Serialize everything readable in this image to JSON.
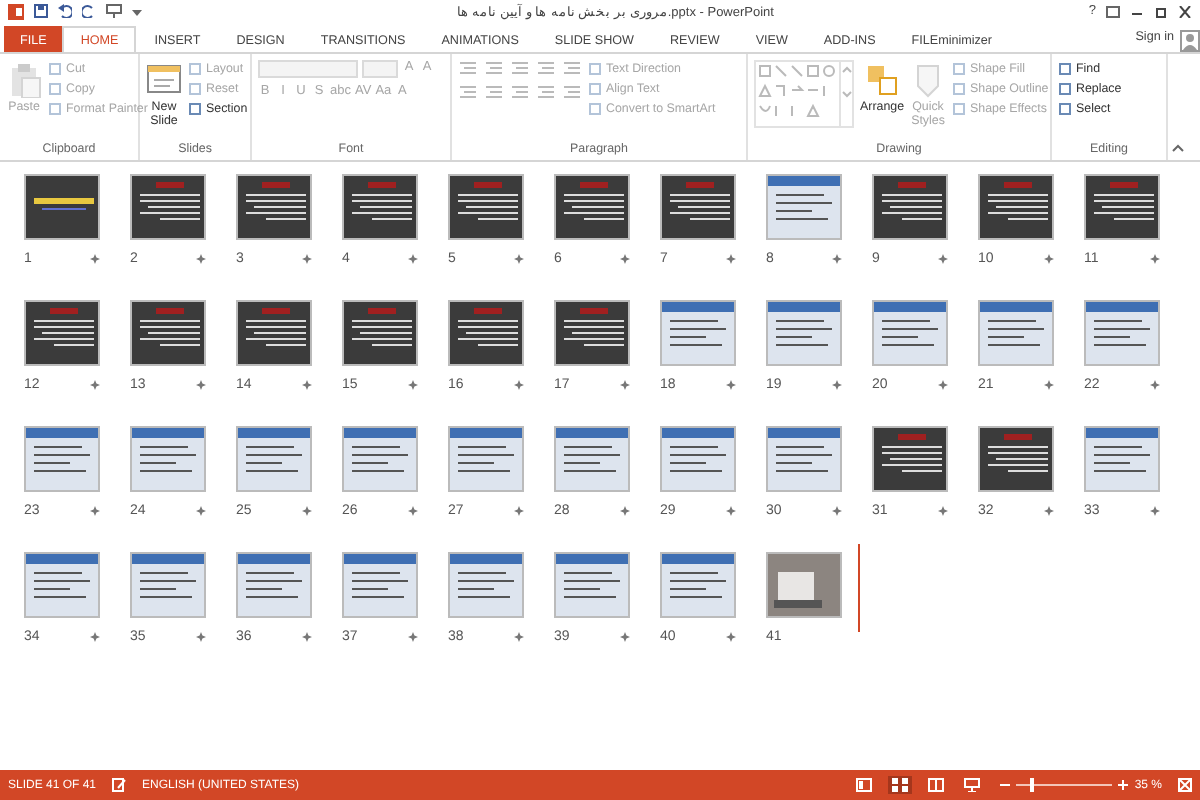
{
  "window": {
    "title": "مروری بر بخش نامه ها و آیین نامه ها.pptx - PowerPoint",
    "help": "?"
  },
  "tabs": [
    {
      "label": "FILE",
      "kind": "file",
      "selected": false
    },
    {
      "label": "HOME",
      "kind": "tab",
      "selected": true
    },
    {
      "label": "INSERT",
      "kind": "tab",
      "selected": false
    },
    {
      "label": "DESIGN",
      "kind": "tab",
      "selected": false
    },
    {
      "label": "TRANSITIONS",
      "kind": "tab",
      "selected": false
    },
    {
      "label": "ANIMATIONS",
      "kind": "tab",
      "selected": false
    },
    {
      "label": "SLIDE SHOW",
      "kind": "tab",
      "selected": false
    },
    {
      "label": "REVIEW",
      "kind": "tab",
      "selected": false
    },
    {
      "label": "VIEW",
      "kind": "tab",
      "selected": false
    },
    {
      "label": "ADD-INS",
      "kind": "tab",
      "selected": false
    },
    {
      "label": "FILEminimizer",
      "kind": "tab",
      "selected": false
    }
  ],
  "sign_in": "Sign in",
  "ribbon_groups": [
    {
      "name": "Clipboard",
      "items": [
        {
          "kind": "large",
          "label": "Paste",
          "disabled": true
        },
        {
          "kind": "small",
          "label": "Cut",
          "disabled": true
        },
        {
          "kind": "small",
          "label": "Copy",
          "disabled": true
        },
        {
          "kind": "small",
          "label": "Format Painter",
          "disabled": true
        }
      ]
    },
    {
      "name": "Slides",
      "items": [
        {
          "kind": "large",
          "label": "New Slide",
          "disabled": false
        },
        {
          "kind": "small",
          "label": "Layout",
          "disabled": true
        },
        {
          "kind": "small",
          "label": "Reset",
          "disabled": true
        },
        {
          "kind": "small",
          "label": "Section",
          "disabled": false
        }
      ]
    },
    {
      "name": "Font",
      "items": [
        {
          "kind": "field",
          "disabled": true
        },
        {
          "kind": "field",
          "disabled": true
        },
        {
          "kind": "glyph",
          "label": "A",
          "disabled": true
        },
        {
          "kind": "glyph",
          "label": "A",
          "disabled": true
        },
        {
          "kind": "glyph",
          "label": "B",
          "disabled": true
        },
        {
          "kind": "glyph",
          "label": "I",
          "disabled": true
        },
        {
          "kind": "glyph",
          "label": "U",
          "disabled": true
        },
        {
          "kind": "glyph",
          "label": "S",
          "disabled": true
        },
        {
          "kind": "glyph",
          "label": "abc",
          "disabled": true
        },
        {
          "kind": "glyph",
          "label": "AV",
          "disabled": true
        },
        {
          "kind": "glyph",
          "label": "Aa",
          "disabled": true
        },
        {
          "kind": "glyph",
          "label": "A",
          "disabled": true
        }
      ]
    },
    {
      "name": "Paragraph",
      "items": [
        {
          "kind": "tool",
          "disabled": true
        },
        {
          "kind": "tool",
          "disabled": true
        },
        {
          "kind": "tool",
          "disabled": true
        },
        {
          "kind": "tool",
          "disabled": true
        },
        {
          "kind": "tool",
          "disabled": true
        },
        {
          "kind": "tool",
          "disabled": true
        },
        {
          "kind": "tool",
          "disabled": true
        },
        {
          "kind": "tool",
          "disabled": true
        },
        {
          "kind": "tool",
          "disabled": true
        },
        {
          "kind": "tool",
          "disabled": true
        },
        {
          "kind": "small",
          "label": "Text Direction",
          "disabled": true
        },
        {
          "kind": "small",
          "label": "Align Text",
          "disabled": true
        },
        {
          "kind": "small",
          "label": "Convert to SmartArt",
          "disabled": true
        }
      ]
    },
    {
      "name": "Drawing",
      "items": [
        {
          "kind": "gallery",
          "disabled": true
        },
        {
          "kind": "large",
          "label": "Arrange",
          "disabled": false
        },
        {
          "kind": "large",
          "label": "Quick Styles",
          "disabled": true
        },
        {
          "kind": "small",
          "label": "Shape Fill",
          "disabled": true
        },
        {
          "kind": "small",
          "label": "Shape Outline",
          "disabled": true
        },
        {
          "kind": "small",
          "label": "Shape Effects",
          "disabled": true
        }
      ]
    },
    {
      "name": "Editing",
      "items": [
        {
          "kind": "small",
          "label": "Find",
          "disabled": false
        },
        {
          "kind": "small",
          "label": "Replace",
          "disabled": false
        },
        {
          "kind": "small",
          "label": "Select",
          "disabled": false
        }
      ]
    }
  ],
  "slides": [
    {
      "number": "1",
      "kind": "title",
      "transition": true
    },
    {
      "number": "2",
      "kind": "dark",
      "transition": true
    },
    {
      "number": "3",
      "kind": "dark",
      "transition": true
    },
    {
      "number": "4",
      "kind": "dark",
      "transition": true
    },
    {
      "number": "5",
      "kind": "dark",
      "transition": true
    },
    {
      "number": "6",
      "kind": "dark",
      "transition": true
    },
    {
      "number": "7",
      "kind": "dark",
      "transition": true
    },
    {
      "number": "8",
      "kind": "light",
      "transition": true
    },
    {
      "number": "9",
      "kind": "dark",
      "transition": true
    },
    {
      "number": "10",
      "kind": "dark",
      "transition": true
    },
    {
      "number": "11",
      "kind": "dark",
      "transition": true
    },
    {
      "number": "12",
      "kind": "dark",
      "transition": true
    },
    {
      "number": "13",
      "kind": "dark",
      "transition": true
    },
    {
      "number": "14",
      "kind": "dark",
      "transition": true
    },
    {
      "number": "15",
      "kind": "dark",
      "transition": true
    },
    {
      "number": "16",
      "kind": "dark",
      "transition": true
    },
    {
      "number": "17",
      "kind": "dark",
      "transition": true
    },
    {
      "number": "18",
      "kind": "light",
      "transition": true
    },
    {
      "number": "19",
      "kind": "light",
      "transition": true
    },
    {
      "number": "20",
      "kind": "light",
      "transition": true
    },
    {
      "number": "21",
      "kind": "light",
      "transition": true
    },
    {
      "number": "22",
      "kind": "light",
      "transition": true
    },
    {
      "number": "23",
      "kind": "light",
      "transition": true
    },
    {
      "number": "24",
      "kind": "light",
      "transition": true
    },
    {
      "number": "25",
      "kind": "light",
      "transition": true
    },
    {
      "number": "26",
      "kind": "light",
      "transition": true
    },
    {
      "number": "27",
      "kind": "light",
      "transition": true
    },
    {
      "number": "28",
      "kind": "light",
      "transition": true
    },
    {
      "number": "29",
      "kind": "light",
      "transition": true
    },
    {
      "number": "30",
      "kind": "light",
      "transition": true
    },
    {
      "number": "31",
      "kind": "dark",
      "transition": true
    },
    {
      "number": "32",
      "kind": "dark",
      "transition": true
    },
    {
      "number": "33",
      "kind": "light",
      "transition": true
    },
    {
      "number": "34",
      "kind": "light",
      "transition": true
    },
    {
      "number": "35",
      "kind": "light",
      "transition": true
    },
    {
      "number": "36",
      "kind": "light",
      "transition": true
    },
    {
      "number": "37",
      "kind": "light",
      "transition": true
    },
    {
      "number": "38",
      "kind": "light",
      "transition": true
    },
    {
      "number": "39",
      "kind": "light",
      "transition": true
    },
    {
      "number": "40",
      "kind": "light",
      "transition": true
    },
    {
      "number": "41",
      "kind": "photo",
      "transition": false
    }
  ],
  "status_bar": {
    "slide_info": "SLIDE 41 OF 41",
    "language": "ENGLISH (UNITED STATES)",
    "views": [
      {
        "kind": "normal",
        "selected": false
      },
      {
        "kind": "sorter",
        "selected": true
      },
      {
        "kind": "reading",
        "selected": false
      },
      {
        "kind": "slideshow",
        "selected": false
      }
    ],
    "zoom": {
      "level": 0.15,
      "reading": "35 %"
    }
  }
}
